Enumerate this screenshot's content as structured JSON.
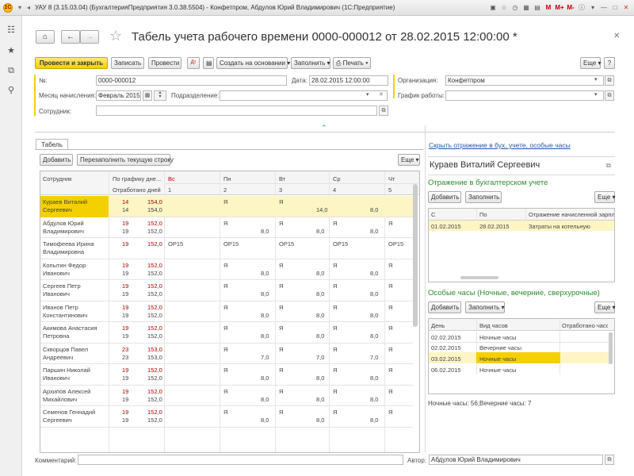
{
  "window": {
    "app_logo": "1С",
    "title": "УАУ 8 (3.15.03.04) (БухгалтерияПредприятия 3.0.38.5504) - Конфетпром, Абдулов Юрий Владимирович   (1С:Предприятие)"
  },
  "form": {
    "title": "Табель учета рабочего времени 0000-000012 от 28.02.2015 12:00:00 *"
  },
  "toolbar": {
    "post_close": "Провести и закрыть",
    "save": "Записать",
    "post": "Провести",
    "create_based": "Создать на основании",
    "fill": "Заполнить",
    "print": "Печать",
    "more": "Еще",
    "help": "?"
  },
  "fields": {
    "number_label": "№:",
    "number": "0000-000012",
    "date_label": "Дата:",
    "date": "28.02.2015 12:00:00",
    "org_label": "Организация:",
    "org": "Конфетпром",
    "month_label": "Месяц начисления:",
    "month": "Февраль 2015",
    "dept_label": "Подразделение:",
    "dept": "",
    "schedule_label": "График работы:",
    "schedule": "",
    "employee_label": "Сотрудник:",
    "employee": ""
  },
  "tabs": {
    "table_tab": "Табель"
  },
  "timesheet": {
    "add": "Добавить",
    "refill": "Перезаполнить текущую строку",
    "more": "Еще",
    "headers": {
      "employee": "Сотрудник",
      "by_schedule": "По графику дне...",
      "worked_days": "Отработано дней",
      "days": [
        {
          "name": "Вс",
          "num": "1"
        },
        {
          "name": "Пн",
          "num": "2"
        },
        {
          "name": "Вт",
          "num": "3"
        },
        {
          "name": "Ср",
          "num": "4"
        },
        {
          "name": "Чт",
          "num": "5"
        }
      ]
    },
    "rows": [
      {
        "name1": "Кураев Виталий",
        "name2": "Сергеевич",
        "p1": "14",
        "h1": "154,0",
        "p2": "14",
        "h2": "154,0",
        "d1a": "",
        "d1b": "",
        "d2a": "Я",
        "d2b": "",
        "d3a": "Я",
        "d3b": "14,0",
        "d4a": "",
        "d4b": "8,0",
        "d5a": "",
        "d5b": ""
      },
      {
        "name1": "Абдулов Юрий",
        "name2": "Владимирович",
        "p1": "19",
        "h1": "152,0",
        "p2": "19",
        "h2": "152,0",
        "d1a": "",
        "d1b": "",
        "d2a": "Я",
        "d2b": "8,0",
        "d3a": "Я",
        "d3b": "8,0",
        "d4a": "Я",
        "d4b": "8,0",
        "d5a": "Я",
        "d5b": ""
      },
      {
        "name1": "Тимофеева Ирина",
        "name2": "Владимировна",
        "p1": "19",
        "h1": "152,0",
        "p2": "",
        "h2": "",
        "d1a": "ОР15",
        "d1b": "",
        "d2a": "ОР15",
        "d2b": "",
        "d3a": "ОР15",
        "d3b": "",
        "d4a": "ОР15",
        "d4b": "",
        "d5a": "ОР15",
        "d5b": ""
      },
      {
        "name1": "Копытин Федор",
        "name2": "Иванович",
        "p1": "19",
        "h1": "152,0",
        "p2": "19",
        "h2": "152,0",
        "d1a": "",
        "d1b": "",
        "d2a": "Я",
        "d2b": "8,0",
        "d3a": "Я",
        "d3b": "8,0",
        "d4a": "Я",
        "d4b": "8,0",
        "d5a": "Я",
        "d5b": ""
      },
      {
        "name1": "Сергеев Петр",
        "name2": "Иванович",
        "p1": "19",
        "h1": "152,0",
        "p2": "19",
        "h2": "152,0",
        "d1a": "",
        "d1b": "",
        "d2a": "Я",
        "d2b": "8,0",
        "d3a": "Я",
        "d3b": "8,0",
        "d4a": "Я",
        "d4b": "8,0",
        "d5a": "Я",
        "d5b": ""
      },
      {
        "name1": "Иванов  Петр",
        "name2": "Константинович",
        "p1": "19",
        "h1": "152,0",
        "p2": "19",
        "h2": "152,0",
        "d1a": "",
        "d1b": "",
        "d2a": "Я",
        "d2b": "8,0",
        "d3a": "Я",
        "d3b": "8,0",
        "d4a": "Я",
        "d4b": "8,0",
        "d5a": "Я",
        "d5b": ""
      },
      {
        "name1": "Акимова Анастасия",
        "name2": "Петровна",
        "p1": "19",
        "h1": "152,0",
        "p2": "19",
        "h2": "152,0",
        "d1a": "",
        "d1b": "",
        "d2a": "Я",
        "d2b": "8,0",
        "d3a": "Я",
        "d3b": "8,0",
        "d4a": "Я",
        "d4b": "8,0",
        "d5a": "Я",
        "d5b": ""
      },
      {
        "name1": "Скворцов Павел",
        "name2": "Андреевич",
        "p1": "23",
        "h1": "153,0",
        "p2": "23",
        "h2": "153,0",
        "d1a": "",
        "d1b": "",
        "d2a": "Я",
        "d2b": "7,0",
        "d3a": "Я",
        "d3b": "7,0",
        "d4a": "Я",
        "d4b": "7,0",
        "d5a": "Я",
        "d5b": ""
      },
      {
        "name1": "Паршин Николай",
        "name2": "Иванович",
        "p1": "19",
        "h1": "152,0",
        "p2": "19",
        "h2": "152,0",
        "d1a": "",
        "d1b": "",
        "d2a": "Я",
        "d2b": "8,0",
        "d3a": "Я",
        "d3b": "8,0",
        "d4a": "Я",
        "d4b": "8,0",
        "d5a": "Я",
        "d5b": ""
      },
      {
        "name1": "Архипов Алексей",
        "name2": "Михайлович",
        "p1": "19",
        "h1": "152,0",
        "p2": "19",
        "h2": "152,0",
        "d1a": "",
        "d1b": "",
        "d2a": "Я",
        "d2b": "8,0",
        "d3a": "Я",
        "d3b": "8,0",
        "d4a": "Я",
        "d4b": "8,0",
        "d5a": "Я",
        "d5b": ""
      },
      {
        "name1": "Семенов Геннадий",
        "name2": "Сергеевич",
        "p1": "19",
        "h1": "152,0",
        "p2": "19",
        "h2": "152,0",
        "d1a": "",
        "d1b": "",
        "d2a": "Я",
        "d2b": "8,0",
        "d3a": "Я",
        "d3b": "8,0",
        "d4a": "Я",
        "d4b": "8,0",
        "d5a": "Я",
        "d5b": ""
      }
    ]
  },
  "right": {
    "hide_link": "Скрыть отражение в бух. учете, особые часы",
    "employee_name": "Кураев Виталий Сергеевич",
    "accounting_title": "Отражение в бухгалтерском учете",
    "add": "Добавить",
    "fill": "Заполнить",
    "more": "Еще",
    "acc_headers": {
      "from": "С",
      "to": "По",
      "reflect": "Отражение начисленной зарплаты"
    },
    "acc_rows": [
      {
        "from": "01.02.2015",
        "to": "28.02.2015",
        "reflect": "Затраты на котельную"
      }
    ],
    "special_title": "Особые часы (Ночные, вечерние, сверхурочные)",
    "sp_headers": {
      "day": "День",
      "kind": "Вид часов",
      "worked": "Отработано часов"
    },
    "sp_rows": [
      {
        "day": "02.02.2015",
        "kind": "Ночные часы"
      },
      {
        "day": "02.02.2015",
        "kind": "Вечерние часы"
      },
      {
        "day": "03.02.2015",
        "kind": "Ночные часы"
      },
      {
        "day": "06.02.2015",
        "kind": "Ночные часы"
      }
    ],
    "summary": "Ночные часы: 56;Вечерние часы: 7"
  },
  "footer": {
    "comment_label": "Комментарий:",
    "comment": "",
    "author_label": "Автор:",
    "author": "Абдулов Юрий Владимирович"
  },
  "colors": {
    "accent_yellow": "#f5d000",
    "selected_row": "#fdf5c4",
    "link": "#1f5aa0",
    "green_header": "#2d8b2d",
    "red_number": "#b00000"
  }
}
